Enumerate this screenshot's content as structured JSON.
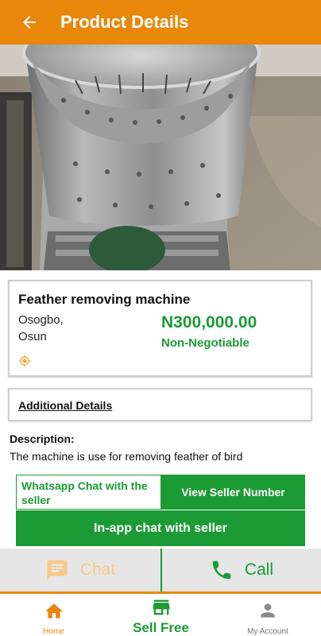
{
  "header": {
    "title": "Product Details"
  },
  "product": {
    "name": "Feather removing machine",
    "location_city": "Osogbo,",
    "location_state": "Osun",
    "price": "N300,000.00",
    "negotiable": "Non-Negotiable"
  },
  "additional_details_label": "Additional Details",
  "description": {
    "heading": "Description:",
    "text": "The machine is use for removing feather of bird"
  },
  "buttons": {
    "whatsapp": "Whatsapp Chat with the seller",
    "view_number": "View Seller Number",
    "in_app_chat": "In-app chat with seller"
  },
  "actions": {
    "chat": "Chat",
    "call": "Call"
  },
  "bottom_nav": {
    "home": "Home",
    "sell": "Sell Free",
    "account": "My Account"
  },
  "colors": {
    "brand_orange": "#e8870a",
    "brand_green": "#1c9a35"
  }
}
